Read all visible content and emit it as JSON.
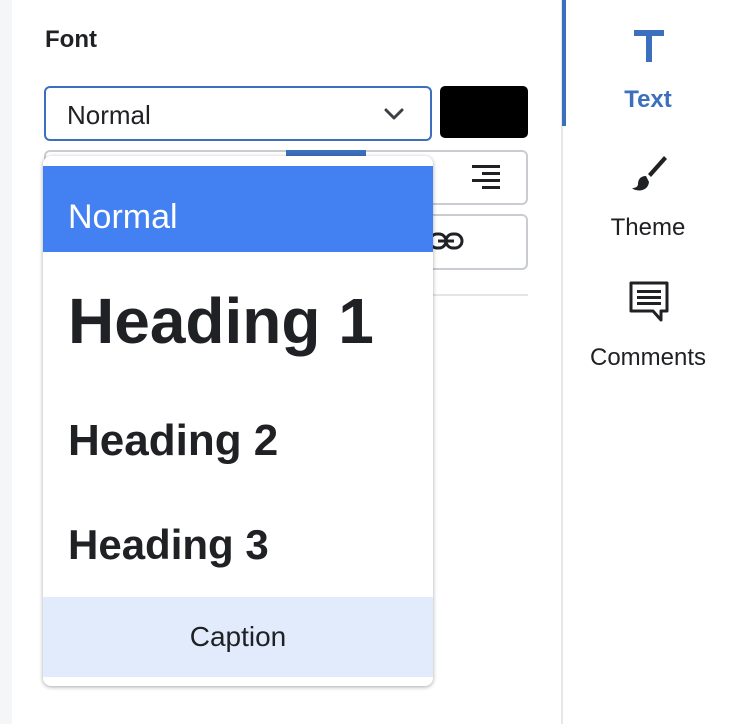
{
  "panel": {
    "section_title": "Font",
    "font_select": {
      "value": "Normal"
    },
    "color_swatch": "#000000"
  },
  "dropdown": {
    "items": [
      {
        "label": "Normal",
        "selected": true
      },
      {
        "label": "Heading 1"
      },
      {
        "label": "Heading 2"
      },
      {
        "label": "Heading 3"
      },
      {
        "label": "Caption",
        "hovered": true
      }
    ]
  },
  "rail": {
    "items": [
      {
        "label": "Text",
        "icon": "text-icon",
        "active": true
      },
      {
        "label": "Theme",
        "icon": "paintbrush-icon"
      },
      {
        "label": "Comments",
        "icon": "comment-icon"
      }
    ]
  },
  "colors": {
    "accent": "#3c6fbe",
    "selected_item": "#4381f2",
    "hover_item": "#e2ebfc"
  }
}
